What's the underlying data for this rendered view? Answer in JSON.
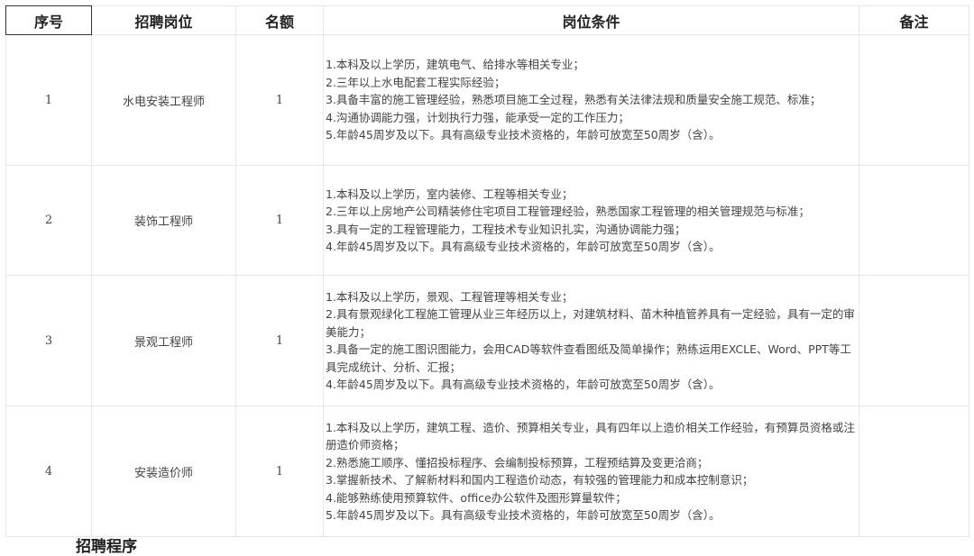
{
  "table": {
    "headers": {
      "seq": "序号",
      "position": "招聘岗位",
      "quota": "名额",
      "conditions": "岗位条件",
      "remarks": "备注"
    },
    "rows": [
      {
        "seq": "1",
        "position": "水电安装工程师",
        "quota": "1",
        "conditions": [
          "1.本科及以上学历，建筑电气、给排水等相关专业；",
          "2.三年以上水电配套工程实际经验；",
          "3.具备丰富的施工管理经验，熟悉项目施工全过程，熟悉有关法律法规和质量安全施工规范、标准；",
          "4.沟通协调能力强，计划执行力强，能承受一定的工作压力；",
          "5.年龄45周岁及以下。具有高级专业技术资格的，年龄可放宽至50周岁（含）。"
        ],
        "remarks": ""
      },
      {
        "seq": "2",
        "position": "装饰工程师",
        "quota": "1",
        "conditions": [
          "1.本科及以上学历，室内装修、工程等相关专业；",
          "2.三年以上房地产公司精装修住宅项目工程管理经验，熟悉国家工程管理的相关管理规范与标准；",
          "3.具有一定的工程管理能力，工程技术专业知识扎实，沟通协调能力强；",
          "4.年龄45周岁及以下。具有高级专业技术资格的，年龄可放宽至50周岁（含）。"
        ],
        "remarks": ""
      },
      {
        "seq": "3",
        "position": "景观工程师",
        "quota": "1",
        "conditions": [
          "1.本科及以上学历，景观、工程管理等相关专业；",
          "2.具有景观绿化工程施工管理从业三年经历以上，对建筑材料、苗木种植管养具有一定经验，具有一定的审美能力；",
          "3.具备一定的施工图识图能力，会用CAD等软件查看图纸及简单操作；熟练运用EXCLE、Word、PPT等工具完成统计、分析、汇报；",
          "4.年龄45周岁及以下。具有高级专业技术资格的，年龄可放宽至50周岁（含）。"
        ],
        "remarks": ""
      },
      {
        "seq": "4",
        "position": "安装造价师",
        "quota": "1",
        "conditions": [
          "1.本科及以上学历，建筑工程、造价、预算相关专业，具有四年以上造价相关工作经验，有预算员资格或注册造价师资格；",
          "2.熟悉施工顺序、懂招投标程序、会编制投标预算，工程预结算及变更洽商；",
          "3.掌握新技术、了解新材料和国内工程造价动态，有较强的管理能力和成本控制意识；",
          "4.能够熟练使用预算软件、office办公软件及图形算量软件；",
          "5.年龄45周岁及以下。具有高级专业技术资格的，年龄可放宽至50周岁（含）。"
        ],
        "remarks": ""
      }
    ]
  },
  "footer": {
    "partial_heading": "招聘程序"
  }
}
